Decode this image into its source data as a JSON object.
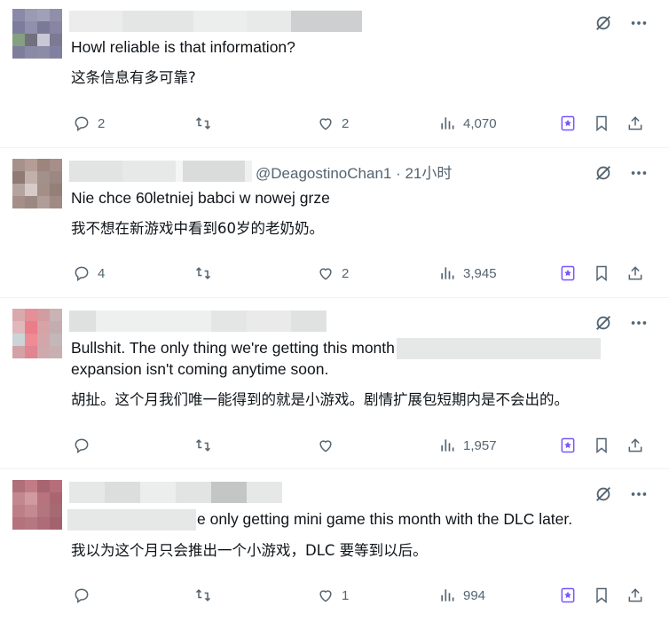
{
  "colors": {
    "accent": "#7856ff",
    "muted": "#536471",
    "text": "#0f1419",
    "divider": "#eff3f4"
  },
  "tweets": [
    {
      "handle_time": "",
      "lines": [
        "Howl reliable is that information?"
      ],
      "translation": "这条信息有多可靠?",
      "replies": "2",
      "retweets": "",
      "likes": "2",
      "views": "4,070"
    },
    {
      "handle_time": "@DeagostinoChan1 · 21小时",
      "lines": [
        "Nie chce 60letniej babci w nowej grze"
      ],
      "translation": "我不想在新游戏中看到60岁的老奶奶。",
      "replies": "4",
      "retweets": "",
      "likes": "2",
      "views": "3,945"
    },
    {
      "handle_time": "",
      "lines": [
        "Bullshit. The only thing we're getting this month",
        "expansion isn't coming anytime soon."
      ],
      "translation": "胡扯。这个月我们唯一能得到的就是小游戏。剧情扩展包短期内是不会出的。",
      "replies": "",
      "retweets": "",
      "likes": "",
      "views": "1,957"
    },
    {
      "handle_time": "",
      "lines": [
        "e only getting  mini game this month with the DLC later."
      ],
      "translation": "我以为这个月只会推出一个小游戏，DLC 要等到以后。",
      "replies": "",
      "retweets": "",
      "likes": "1",
      "views": "994"
    }
  ],
  "icons": {
    "top": [
      "grok-slash-icon",
      "more-icon"
    ],
    "actions": [
      "reply-icon",
      "retweet-icon",
      "like-icon",
      "views-icon",
      "grok-star-icon",
      "bookmark-icon",
      "share-icon"
    ]
  }
}
